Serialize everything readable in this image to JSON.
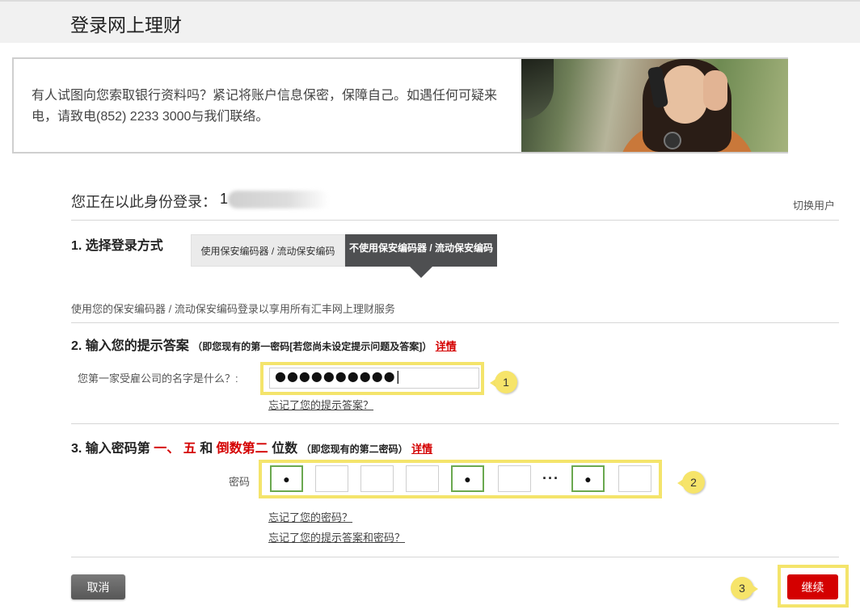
{
  "header": {
    "title": "登录网上理财"
  },
  "banner": {
    "text": "有人试图向您索取银行资料吗？紧记将账户信息保密，保障自己。如遇任何可疑来电，请致电(852) 2233 3000与我们联络。"
  },
  "identity": {
    "label": "您正在以此身份登录：",
    "user_id_visible": "1",
    "switch_user": "切换用户"
  },
  "section1": {
    "title": "1. 选择登录方式",
    "tab_with_token": "使用保安编码器 / 流动保安编码",
    "tab_without_token": "不使用保安编码器 / 流动保安编码",
    "description": "使用您的保安编码器 / 流动保安编码登录以享用所有汇丰网上理财服务"
  },
  "section2": {
    "title": "2. 输入您的提示答案",
    "subtitle": "（即您现有的第一密码[若您尚未设定提示问题及答案]）",
    "details_link": "详情",
    "question": "您第一家受雇公司的名字是什么？:",
    "answer_masked": "●●●●●●●●●●",
    "forgot_answer": "忘记了您的提示答案？",
    "callout": "1"
  },
  "section3": {
    "title_prefix": "3. 输入密码第",
    "first": "一",
    "sep1": "、",
    "fifth": "五",
    "and": "和",
    "second_last": "倒数第二",
    "suffix": "位数",
    "subtitle": "（即您现有的第二密码）",
    "details_link": "详情",
    "password_label": "密码",
    "box_dots": [
      "●",
      "",
      "",
      "",
      "●",
      "",
      "●",
      ""
    ],
    "ellipsis": "···",
    "forgot_password": "忘记了您的密码？",
    "forgot_both": "忘记了您的提示答案和密码？",
    "callout": "2"
  },
  "actions": {
    "cancel": "取消",
    "continue": "继续",
    "callout": "3"
  },
  "colors": {
    "accent_red": "#d40000",
    "highlight_yellow": "#f4e46b",
    "active_green": "#6aa84f",
    "tab_dark": "#4e4f51"
  }
}
